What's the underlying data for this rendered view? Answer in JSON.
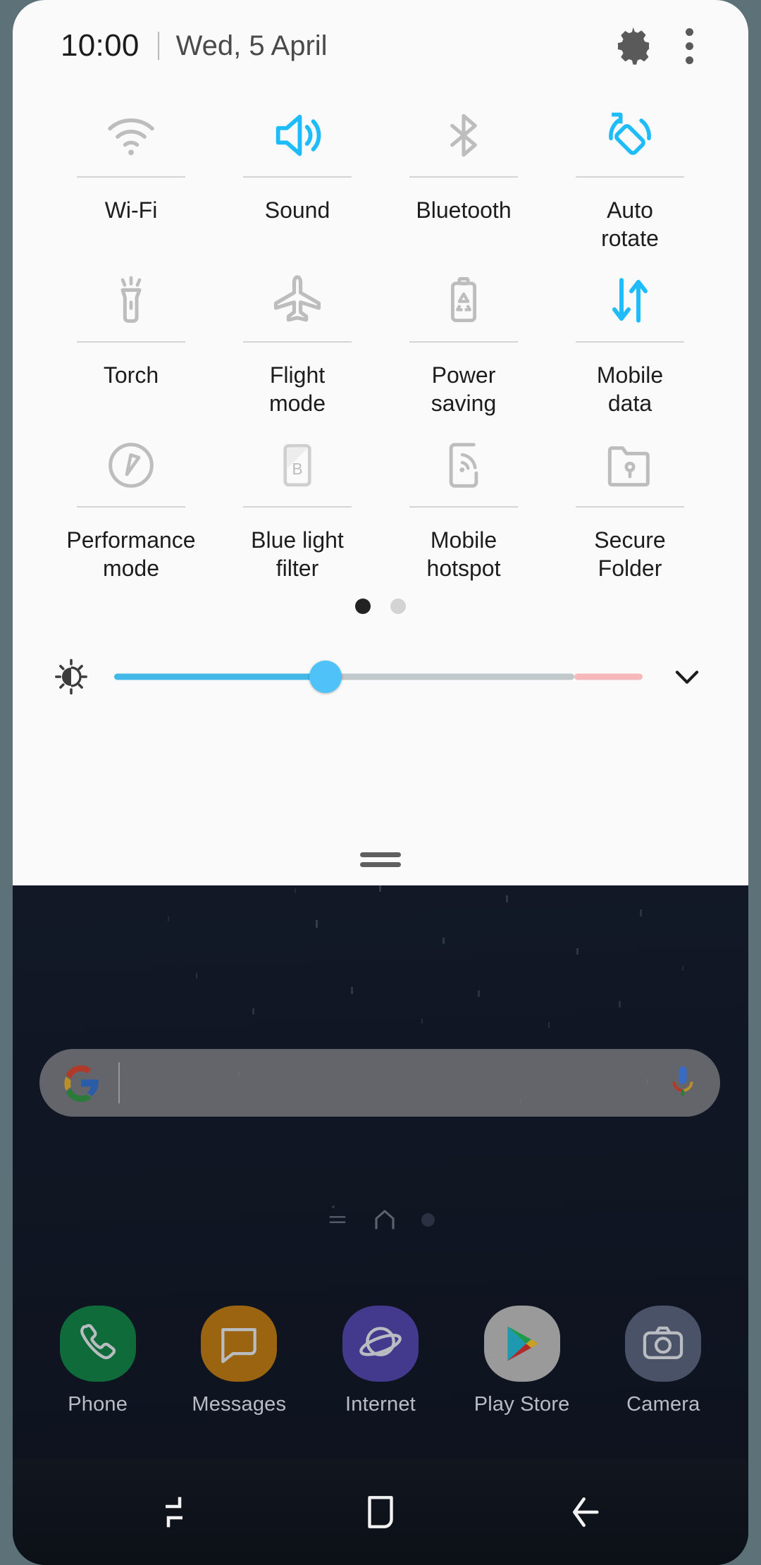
{
  "status_bar": {
    "time": "10:00",
    "date": "Wed, 5 April",
    "settings_icon": "gear-icon",
    "overflow_icon": "more-vertical-icon"
  },
  "quick_settings": {
    "accent_color": "#1EBCFA",
    "inactive_color": "#bdbdbd",
    "panel_bg": "#fafafa",
    "tiles": [
      {
        "label": "Wi-Fi",
        "icon": "wifi-icon",
        "active": false
      },
      {
        "label": "Sound",
        "icon": "sound-icon",
        "active": true
      },
      {
        "label": "Bluetooth",
        "icon": "bluetooth-icon",
        "active": false
      },
      {
        "label": "Auto\nrotate",
        "icon": "auto-rotate-icon",
        "active": true
      },
      {
        "label": "Torch",
        "icon": "torch-icon",
        "active": false
      },
      {
        "label": "Flight\nmode",
        "icon": "flight-mode-icon",
        "active": false
      },
      {
        "label": "Power\nsaving",
        "icon": "power-saving-icon",
        "active": false
      },
      {
        "label": "Mobile\ndata",
        "icon": "mobile-data-icon",
        "active": true
      },
      {
        "label": "Performance\nmode",
        "icon": "performance-icon",
        "active": false
      },
      {
        "label": "Blue light\nfilter",
        "icon": "blue-light-icon",
        "active": false
      },
      {
        "label": "Mobile\nhotspot",
        "icon": "hotspot-icon",
        "active": false
      },
      {
        "label": "Secure\nFolder",
        "icon": "secure-folder-icon",
        "active": false
      }
    ],
    "pagination": {
      "pages": 2,
      "current": 1
    },
    "brightness": {
      "icon": "brightness-icon",
      "value_percent": 40,
      "warn_start_percent": 87,
      "expand_icon": "chevron-down-icon"
    },
    "drag_handle": "panel-drag-handle"
  },
  "home_screen": {
    "search": {
      "placeholder": "",
      "value": "",
      "logo_icon": "google-g-icon",
      "mic_icon": "microphone-icon"
    },
    "page_indicator": {
      "items": [
        "apps-page-icon",
        "home-page-icon",
        "page-dot"
      ],
      "current": 2
    },
    "dock": [
      {
        "label": "Phone",
        "icon": "phone-icon",
        "bg": "#0f6b3a"
      },
      {
        "label": "Messages",
        "icon": "messages-icon",
        "bg": "#9a6410"
      },
      {
        "label": "Internet",
        "icon": "internet-icon",
        "bg": "#433a8e"
      },
      {
        "label": "Play Store",
        "icon": "play-store-icon",
        "bg": "#9a9a9a"
      },
      {
        "label": "Camera",
        "icon": "camera-icon",
        "bg": "#4a5268"
      }
    ]
  },
  "navigation_bar": {
    "buttons": [
      {
        "label": "Recents",
        "icon": "recents-icon"
      },
      {
        "label": "Home",
        "icon": "home-icon"
      },
      {
        "label": "Back",
        "icon": "back-icon"
      }
    ]
  }
}
